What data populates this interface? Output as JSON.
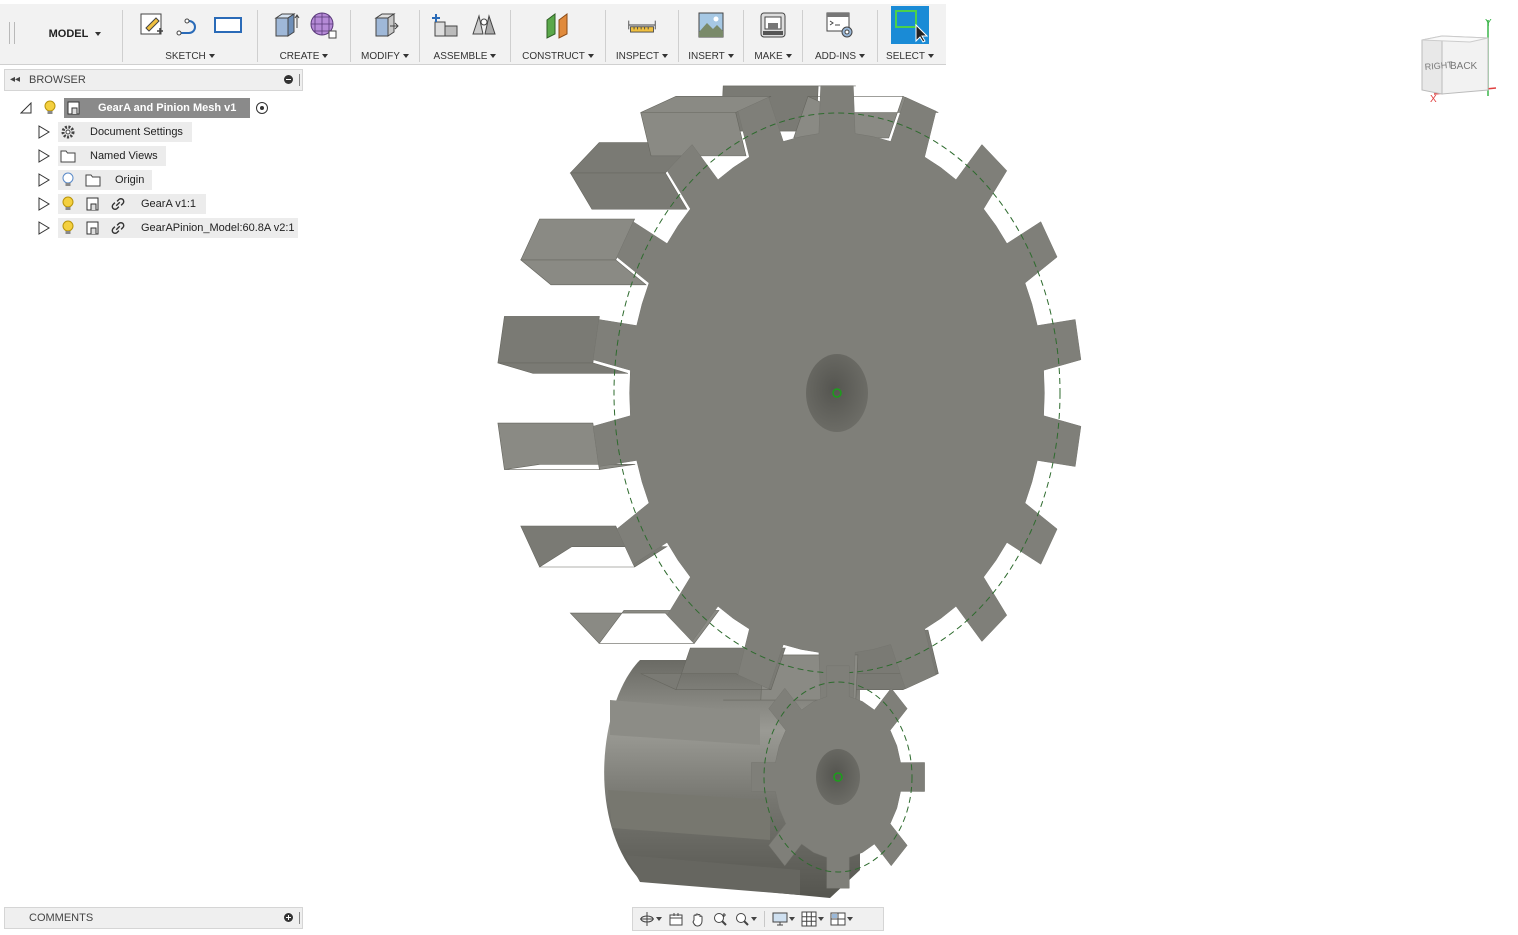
{
  "toolbar": {
    "workspace": "MODEL",
    "groups": [
      {
        "label": "SKETCH",
        "icons": [
          "create-sketch-icon",
          "spline-icon",
          "rectangle-icon"
        ]
      },
      {
        "label": "CREATE",
        "icons": [
          "extrude-icon",
          "form-icon"
        ]
      },
      {
        "label": "MODIFY",
        "icons": [
          "press-pull-icon"
        ]
      },
      {
        "label": "ASSEMBLE",
        "icons": [
          "new-component-icon",
          "joint-icon"
        ]
      },
      {
        "label": "CONSTRUCT",
        "icons": [
          "offset-plane-icon"
        ]
      },
      {
        "label": "INSPECT",
        "icons": [
          "measure-icon"
        ]
      },
      {
        "label": "INSERT",
        "icons": [
          "insert-image-icon"
        ]
      },
      {
        "label": "MAKE",
        "icons": [
          "3d-print-icon"
        ]
      },
      {
        "label": "ADD-INS",
        "icons": [
          "scripts-icon"
        ]
      },
      {
        "label": "SELECT",
        "icons": [
          "select-icon"
        ]
      }
    ]
  },
  "browser": {
    "title": "BROWSER",
    "root": "GearA and Pinion Mesh v1",
    "items": [
      {
        "label": "Document Settings"
      },
      {
        "label": "Named Views"
      },
      {
        "label": "Origin"
      },
      {
        "label": "GearA v1:1"
      },
      {
        "label": "GearAPinion_Model:60.8A v2:1"
      }
    ]
  },
  "comments": {
    "title": "COMMENTS"
  },
  "viewcube": {
    "right": "RIGHT",
    "back": "BACK",
    "axis_x": "X",
    "axis_y": "Y"
  },
  "colors": {
    "gear_face": "#7f7f79",
    "gear_dark": "#5e5e58",
    "pitch_circle": "#2e7d2e",
    "accent": "#1a8bd6"
  }
}
